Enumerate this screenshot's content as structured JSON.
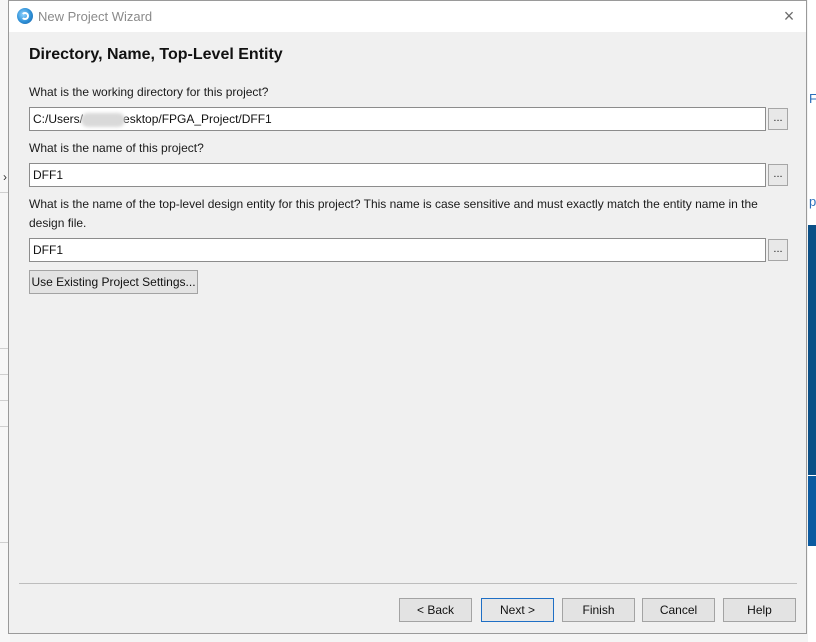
{
  "window": {
    "title": "New Project Wizard",
    "close_glyph": "×"
  },
  "page": {
    "heading": "Directory, Name, Top-Level Entity"
  },
  "directory": {
    "label": "What is the working directory for this project?",
    "value_prefix": "C:/Users/",
    "value_suffix": "esktop/FPGA_Project/DFF1",
    "browse_label": "..."
  },
  "project_name": {
    "label": "What is the name of this project?",
    "value": "DFF1",
    "browse_label": "..."
  },
  "top_level": {
    "label_line1": "What is the name of the top-level design entity for this project? This name is case sensitive and must exactly match the entity name in the",
    "label_line2": "design file.",
    "value": "DFF1",
    "browse_label": "..."
  },
  "buttons": {
    "use_existing": "Use Existing Project Settings...",
    "back": "< Back",
    "next": "Next >",
    "finish": "Finish",
    "cancel": "Cancel",
    "help": "Help"
  },
  "background_app": {
    "left_glyph": "›",
    "right_letter": "F",
    "right_letter2": "p"
  },
  "colors": {
    "dialog_bg": "#f0f0f0",
    "accent": "#1f6fc5",
    "bg_app_blue": "#0a4f86"
  },
  "icons": {
    "app_icon": "quartus-globe-icon",
    "close": "close-icon"
  }
}
